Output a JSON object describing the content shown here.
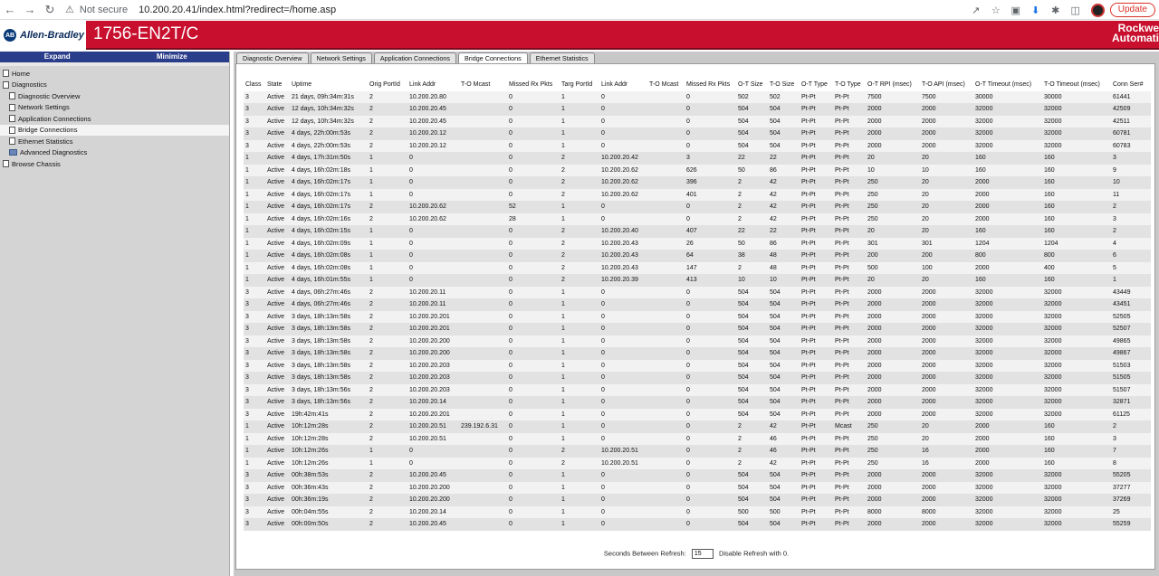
{
  "browser": {
    "security_label": "Not secure",
    "url": "10.200.20.41/index.html?redirect=/home.asp",
    "update_label": "Update"
  },
  "header": {
    "brand": "Allen-Bradley",
    "logo_letters": "AB",
    "model": "1756-EN2T/C",
    "company_line1": "Rockwe",
    "company_line2": "Automati",
    "brand_color": "#c8102e"
  },
  "sidebar": {
    "expand_label": "Expand",
    "minimize_label": "Minimize",
    "items": [
      {
        "label": "Home",
        "level": 0,
        "icon": "page"
      },
      {
        "label": "Diagnostics",
        "level": 0,
        "icon": "page"
      },
      {
        "label": "Diagnostic Overview",
        "level": 1,
        "icon": "page"
      },
      {
        "label": "Network Settings",
        "level": 1,
        "icon": "page"
      },
      {
        "label": "Application Connections",
        "level": 1,
        "icon": "page"
      },
      {
        "label": "Bridge Connections",
        "level": 1,
        "icon": "page",
        "selected": true
      },
      {
        "label": "Ethernet Statistics",
        "level": 1,
        "icon": "page"
      },
      {
        "label": "Advanced Diagnostics",
        "level": 1,
        "icon": "folder"
      },
      {
        "label": "Browse Chassis",
        "level": 0,
        "icon": "page"
      }
    ]
  },
  "tabs": [
    {
      "label": "Diagnostic Overview",
      "active": false
    },
    {
      "label": "Network Settings",
      "active": false
    },
    {
      "label": "Application Connections",
      "active": false
    },
    {
      "label": "Bridge Connections",
      "active": true
    },
    {
      "label": "Ethernet Statistics",
      "active": false
    }
  ],
  "table": {
    "columns": [
      "Class",
      "State",
      "Uptime",
      "Orig PortId",
      "Link Addr",
      "T-O Mcast",
      "Missed Rx Pkts",
      "Targ PortId",
      "Link Addr",
      "T-O Mcast",
      "Missed Rx Pkts",
      "O-T Size",
      "T-O Size",
      "O-T Type",
      "T-O Type",
      "O-T RPI (msec)",
      "T-O API (msec)",
      "O-T Timeout (msec)",
      "T-O Timeout (msec)",
      "Conn Ser#"
    ],
    "rows": [
      [
        "3",
        "Active",
        "21 days, 09h:34m:31s",
        "2",
        "10.200.20.80",
        "",
        "0",
        "1",
        "0",
        "",
        "0",
        "502",
        "502",
        "Pt-Pt",
        "Pt-Pt",
        "7500",
        "7500",
        "30000",
        "30000",
        "61441"
      ],
      [
        "3",
        "Active",
        "12 days, 10h:34m:32s",
        "2",
        "10.200.20.45",
        "",
        "0",
        "1",
        "0",
        "",
        "0",
        "504",
        "504",
        "Pt-Pt",
        "Pt-Pt",
        "2000",
        "2000",
        "32000",
        "32000",
        "42509"
      ],
      [
        "3",
        "Active",
        "12 days, 10h:34m:32s",
        "2",
        "10.200.20.45",
        "",
        "0",
        "1",
        "0",
        "",
        "0",
        "504",
        "504",
        "Pt-Pt",
        "Pt-Pt",
        "2000",
        "2000",
        "32000",
        "32000",
        "42511"
      ],
      [
        "3",
        "Active",
        "4 days, 22h:00m:53s",
        "2",
        "10.200.20.12",
        "",
        "0",
        "1",
        "0",
        "",
        "0",
        "504",
        "504",
        "Pt-Pt",
        "Pt-Pt",
        "2000",
        "2000",
        "32000",
        "32000",
        "60781"
      ],
      [
        "3",
        "Active",
        "4 days, 22h:00m:53s",
        "2",
        "10.200.20.12",
        "",
        "0",
        "1",
        "0",
        "",
        "0",
        "504",
        "504",
        "Pt-Pt",
        "Pt-Pt",
        "2000",
        "2000",
        "32000",
        "32000",
        "60783"
      ],
      [
        "1",
        "Active",
        "4 days, 17h:31m:50s",
        "1",
        "0",
        "",
        "0",
        "2",
        "10.200.20.42",
        "",
        "3",
        "22",
        "22",
        "Pt-Pt",
        "Pt-Pt",
        "20",
        "20",
        "160",
        "160",
        "3"
      ],
      [
        "1",
        "Active",
        "4 days, 16h:02m:18s",
        "1",
        "0",
        "",
        "0",
        "2",
        "10.200.20.62",
        "",
        "626",
        "50",
        "86",
        "Pt-Pt",
        "Pt-Pt",
        "10",
        "10",
        "160",
        "160",
        "9"
      ],
      [
        "1",
        "Active",
        "4 days, 16h:02m:17s",
        "1",
        "0",
        "",
        "0",
        "2",
        "10.200.20.62",
        "",
        "396",
        "2",
        "42",
        "Pt-Pt",
        "Pt-Pt",
        "250",
        "20",
        "2000",
        "160",
        "10"
      ],
      [
        "1",
        "Active",
        "4 days, 16h:02m:17s",
        "1",
        "0",
        "",
        "0",
        "2",
        "10.200.20.62",
        "",
        "401",
        "2",
        "42",
        "Pt-Pt",
        "Pt-Pt",
        "250",
        "20",
        "2000",
        "160",
        "11"
      ],
      [
        "1",
        "Active",
        "4 days, 16h:02m:17s",
        "2",
        "10.200.20.62",
        "",
        "52",
        "1",
        "0",
        "",
        "0",
        "2",
        "42",
        "Pt-Pt",
        "Pt-Pt",
        "250",
        "20",
        "2000",
        "160",
        "2"
      ],
      [
        "1",
        "Active",
        "4 days, 16h:02m:16s",
        "2",
        "10.200.20.62",
        "",
        "28",
        "1",
        "0",
        "",
        "0",
        "2",
        "42",
        "Pt-Pt",
        "Pt-Pt",
        "250",
        "20",
        "2000",
        "160",
        "3"
      ],
      [
        "1",
        "Active",
        "4 days, 16h:02m:15s",
        "1",
        "0",
        "",
        "0",
        "2",
        "10.200.20.40",
        "",
        "407",
        "22",
        "22",
        "Pt-Pt",
        "Pt-Pt",
        "20",
        "20",
        "160",
        "160",
        "2"
      ],
      [
        "1",
        "Active",
        "4 days, 16h:02m:09s",
        "1",
        "0",
        "",
        "0",
        "2",
        "10.200.20.43",
        "",
        "26",
        "50",
        "86",
        "Pt-Pt",
        "Pt-Pt",
        "301",
        "301",
        "1204",
        "1204",
        "4"
      ],
      [
        "1",
        "Active",
        "4 days, 16h:02m:08s",
        "1",
        "0",
        "",
        "0",
        "2",
        "10.200.20.43",
        "",
        "64",
        "38",
        "48",
        "Pt-Pt",
        "Pt-Pt",
        "200",
        "200",
        "800",
        "800",
        "6"
      ],
      [
        "1",
        "Active",
        "4 days, 16h:02m:08s",
        "1",
        "0",
        "",
        "0",
        "2",
        "10.200.20.43",
        "",
        "147",
        "2",
        "48",
        "Pt-Pt",
        "Pt-Pt",
        "500",
        "100",
        "2000",
        "400",
        "5"
      ],
      [
        "1",
        "Active",
        "4 days, 16h:01m:55s",
        "1",
        "0",
        "",
        "0",
        "2",
        "10.200.20.39",
        "",
        "413",
        "10",
        "10",
        "Pt-Pt",
        "Pt-Pt",
        "20",
        "20",
        "160",
        "160",
        "1"
      ],
      [
        "3",
        "Active",
        "4 days, 06h:27m:46s",
        "2",
        "10.200.20.11",
        "",
        "0",
        "1",
        "0",
        "",
        "0",
        "504",
        "504",
        "Pt-Pt",
        "Pt-Pt",
        "2000",
        "2000",
        "32000",
        "32000",
        "43449"
      ],
      [
        "3",
        "Active",
        "4 days, 06h:27m:46s",
        "2",
        "10.200.20.11",
        "",
        "0",
        "1",
        "0",
        "",
        "0",
        "504",
        "504",
        "Pt-Pt",
        "Pt-Pt",
        "2000",
        "2000",
        "32000",
        "32000",
        "43451"
      ],
      [
        "3",
        "Active",
        "3 days, 18h:13m:58s",
        "2",
        "10.200.20.201",
        "",
        "0",
        "1",
        "0",
        "",
        "0",
        "504",
        "504",
        "Pt-Pt",
        "Pt-Pt",
        "2000",
        "2000",
        "32000",
        "32000",
        "52505"
      ],
      [
        "3",
        "Active",
        "3 days, 18h:13m:58s",
        "2",
        "10.200.20.201",
        "",
        "0",
        "1",
        "0",
        "",
        "0",
        "504",
        "504",
        "Pt-Pt",
        "Pt-Pt",
        "2000",
        "2000",
        "32000",
        "32000",
        "52507"
      ],
      [
        "3",
        "Active",
        "3 days, 18h:13m:58s",
        "2",
        "10.200.20.200",
        "",
        "0",
        "1",
        "0",
        "",
        "0",
        "504",
        "504",
        "Pt-Pt",
        "Pt-Pt",
        "2000",
        "2000",
        "32000",
        "32000",
        "49865"
      ],
      [
        "3",
        "Active",
        "3 days, 18h:13m:58s",
        "2",
        "10.200.20.200",
        "",
        "0",
        "1",
        "0",
        "",
        "0",
        "504",
        "504",
        "Pt-Pt",
        "Pt-Pt",
        "2000",
        "2000",
        "32000",
        "32000",
        "49867"
      ],
      [
        "3",
        "Active",
        "3 days, 18h:13m:58s",
        "2",
        "10.200.20.203",
        "",
        "0",
        "1",
        "0",
        "",
        "0",
        "504",
        "504",
        "Pt-Pt",
        "Pt-Pt",
        "2000",
        "2000",
        "32000",
        "32000",
        "51503"
      ],
      [
        "3",
        "Active",
        "3 days, 18h:13m:58s",
        "2",
        "10.200.20.203",
        "",
        "0",
        "1",
        "0",
        "",
        "0",
        "504",
        "504",
        "Pt-Pt",
        "Pt-Pt",
        "2000",
        "2000",
        "32000",
        "32000",
        "51505"
      ],
      [
        "3",
        "Active",
        "3 days, 18h:13m:56s",
        "2",
        "10.200.20.203",
        "",
        "0",
        "1",
        "0",
        "",
        "0",
        "504",
        "504",
        "Pt-Pt",
        "Pt-Pt",
        "2000",
        "2000",
        "32000",
        "32000",
        "51507"
      ],
      [
        "3",
        "Active",
        "3 days, 18h:13m:56s",
        "2",
        "10.200.20.14",
        "",
        "0",
        "1",
        "0",
        "",
        "0",
        "504",
        "504",
        "Pt-Pt",
        "Pt-Pt",
        "2000",
        "2000",
        "32000",
        "32000",
        "32871"
      ],
      [
        "3",
        "Active",
        "19h:42m:41s",
        "2",
        "10.200.20.201",
        "",
        "0",
        "1",
        "0",
        "",
        "0",
        "504",
        "504",
        "Pt-Pt",
        "Pt-Pt",
        "2000",
        "2000",
        "32000",
        "32000",
        "61125"
      ],
      [
        "1",
        "Active",
        "10h:12m:28s",
        "2",
        "10.200.20.51",
        "239.192.6.31",
        "0",
        "1",
        "0",
        "",
        "0",
        "2",
        "42",
        "Pt-Pt",
        "Mcast",
        "250",
        "20",
        "2000",
        "160",
        "2"
      ],
      [
        "1",
        "Active",
        "10h:12m:28s",
        "2",
        "10.200.20.51",
        "",
        "0",
        "1",
        "0",
        "",
        "0",
        "2",
        "46",
        "Pt-Pt",
        "Pt-Pt",
        "250",
        "20",
        "2000",
        "160",
        "3"
      ],
      [
        "1",
        "Active",
        "10h:12m:26s",
        "1",
        "0",
        "",
        "0",
        "2",
        "10.200.20.51",
        "",
        "0",
        "2",
        "46",
        "Pt-Pt",
        "Pt-Pt",
        "250",
        "16",
        "2000",
        "160",
        "7"
      ],
      [
        "1",
        "Active",
        "10h:12m:26s",
        "1",
        "0",
        "",
        "0",
        "2",
        "10.200.20.51",
        "",
        "0",
        "2",
        "42",
        "Pt-Pt",
        "Pt-Pt",
        "250",
        "16",
        "2000",
        "160",
        "8"
      ],
      [
        "3",
        "Active",
        "00h:38m:53s",
        "2",
        "10.200.20.45",
        "",
        "0",
        "1",
        "0",
        "",
        "0",
        "504",
        "504",
        "Pt-Pt",
        "Pt-Pt",
        "2000",
        "2000",
        "32000",
        "32000",
        "55205"
      ],
      [
        "3",
        "Active",
        "00h:36m:43s",
        "2",
        "10.200.20.200",
        "",
        "0",
        "1",
        "0",
        "",
        "0",
        "504",
        "504",
        "Pt-Pt",
        "Pt-Pt",
        "2000",
        "2000",
        "32000",
        "32000",
        "37277"
      ],
      [
        "3",
        "Active",
        "00h:36m:19s",
        "2",
        "10.200.20.200",
        "",
        "0",
        "1",
        "0",
        "",
        "0",
        "504",
        "504",
        "Pt-Pt",
        "Pt-Pt",
        "2000",
        "2000",
        "32000",
        "32000",
        "37269"
      ],
      [
        "3",
        "Active",
        "00h:04m:55s",
        "2",
        "10.200.20.14",
        "",
        "0",
        "1",
        "0",
        "",
        "0",
        "500",
        "500",
        "Pt-Pt",
        "Pt-Pt",
        "8000",
        "8000",
        "32000",
        "32000",
        "25"
      ],
      [
        "3",
        "Active",
        "00h:00m:50s",
        "2",
        "10.200.20.45",
        "",
        "0",
        "1",
        "0",
        "",
        "0",
        "504",
        "504",
        "Pt-Pt",
        "Pt-Pt",
        "2000",
        "2000",
        "32000",
        "32000",
        "55259"
      ]
    ]
  },
  "refresh": {
    "label": "Seconds Between Refresh:",
    "value": "15",
    "hint": "Disable Refresh with 0."
  }
}
